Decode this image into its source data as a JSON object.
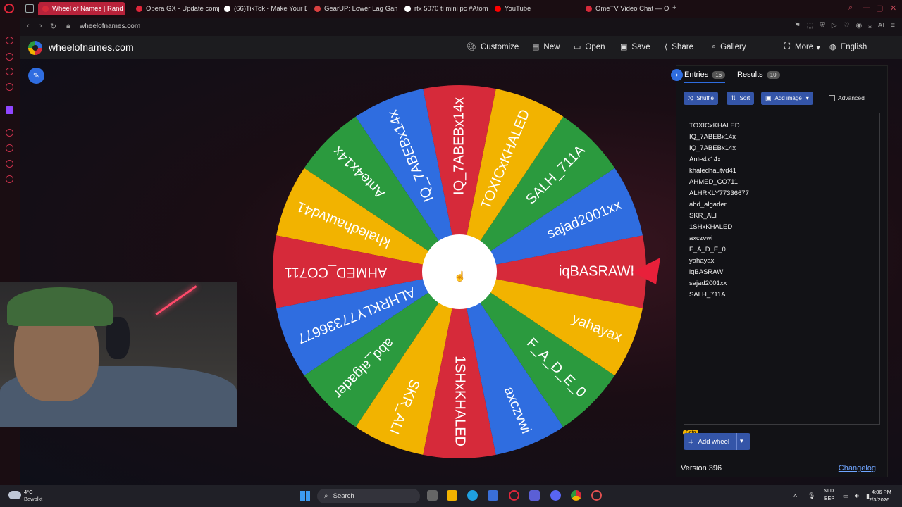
{
  "browser": {
    "tabs": [
      {
        "title": "Wheel of Names | Rand",
        "active": true,
        "color": "#d62a3a"
      },
      {
        "title": "Opera GX - Update comp",
        "active": false,
        "color": "#e0263a"
      },
      {
        "title": "(66)TikTok - Make Your D",
        "active": false,
        "color": "#ffffff"
      },
      {
        "title": "GearUP: Lower Lag Game",
        "active": false,
        "color": "#d94040"
      },
      {
        "title": "rtx 5070 ti mini pc #Atom",
        "active": false,
        "color": "#ffffff"
      },
      {
        "title": "YouTube",
        "active": false,
        "color": "#ff0000"
      },
      {
        "title": "OmeTV Video Chat — Ome",
        "active": false,
        "color": "#d62a3a"
      }
    ],
    "url": "wheelofnames.com"
  },
  "app": {
    "brand": "wheelofnames.com",
    "menu": [
      {
        "key": "customize",
        "label": "Customize",
        "icon": "palette-icon"
      },
      {
        "key": "new",
        "label": "New",
        "icon": "file-icon"
      },
      {
        "key": "open",
        "label": "Open",
        "icon": "folder-icon"
      },
      {
        "key": "save",
        "label": "Save",
        "icon": "save-icon"
      },
      {
        "key": "share",
        "label": "Share",
        "icon": "share-icon"
      },
      {
        "key": "gallery",
        "label": "Gallery",
        "icon": "search-icon"
      },
      {
        "key": "more",
        "label": "More",
        "icon": "chevron-down-icon"
      },
      {
        "key": "english",
        "label": "English",
        "icon": "globe-icon"
      }
    ]
  },
  "wheel": {
    "colors": [
      "#d62a3a",
      "#2f6de0",
      "#2b9a3e",
      "#f2b300"
    ],
    "slices": [
      "iqBASRAWI",
      "sajad2001xx",
      "SALH_711A",
      "TOXICxKHALED",
      "IQ_7ABEBx14x",
      "IQ_7ABEBx14x",
      "Ante4x14x",
      "khaledhautvd41",
      "AHMED_CO711",
      "ALHRKLY77336677",
      "abd_algader",
      "SKR_ALI",
      "1SHxKHALED",
      "axczvwi",
      "F_A_D_E_0",
      "yahayax"
    ]
  },
  "panel": {
    "tab_entries": "Entries",
    "entries_count": "16",
    "tab_results": "Results",
    "results_count": "10",
    "shuffle": "Shuffle",
    "sort": "Sort",
    "add_image": "Add image",
    "advanced": "Advanced",
    "entries": [
      "TOXICxKHALED",
      "IQ_7ABEBx14x",
      "IQ_7ABEBx14x",
      "Ante4x14x",
      "khaledhautvd41",
      "AHMED_CO711",
      "ALHRKLY77336677",
      "abd_algader",
      "SKR_ALI",
      "1SHxKHALED",
      "axczvwi",
      "F_A_D_E_0",
      "yahayax",
      "iqBASRAWI",
      "sajad2001xx",
      "SALH_711A"
    ],
    "beta": "Beta",
    "add_wheel": "Add wheel",
    "version": "Version 396",
    "changelog": "Changelog"
  },
  "taskbar": {
    "temperature": "4°C",
    "condition": "Bewolkt",
    "search": "Search",
    "lang1": "NLD",
    "lang2": "BEP",
    "time": "4:06 PM",
    "date": "2/3/2026"
  }
}
